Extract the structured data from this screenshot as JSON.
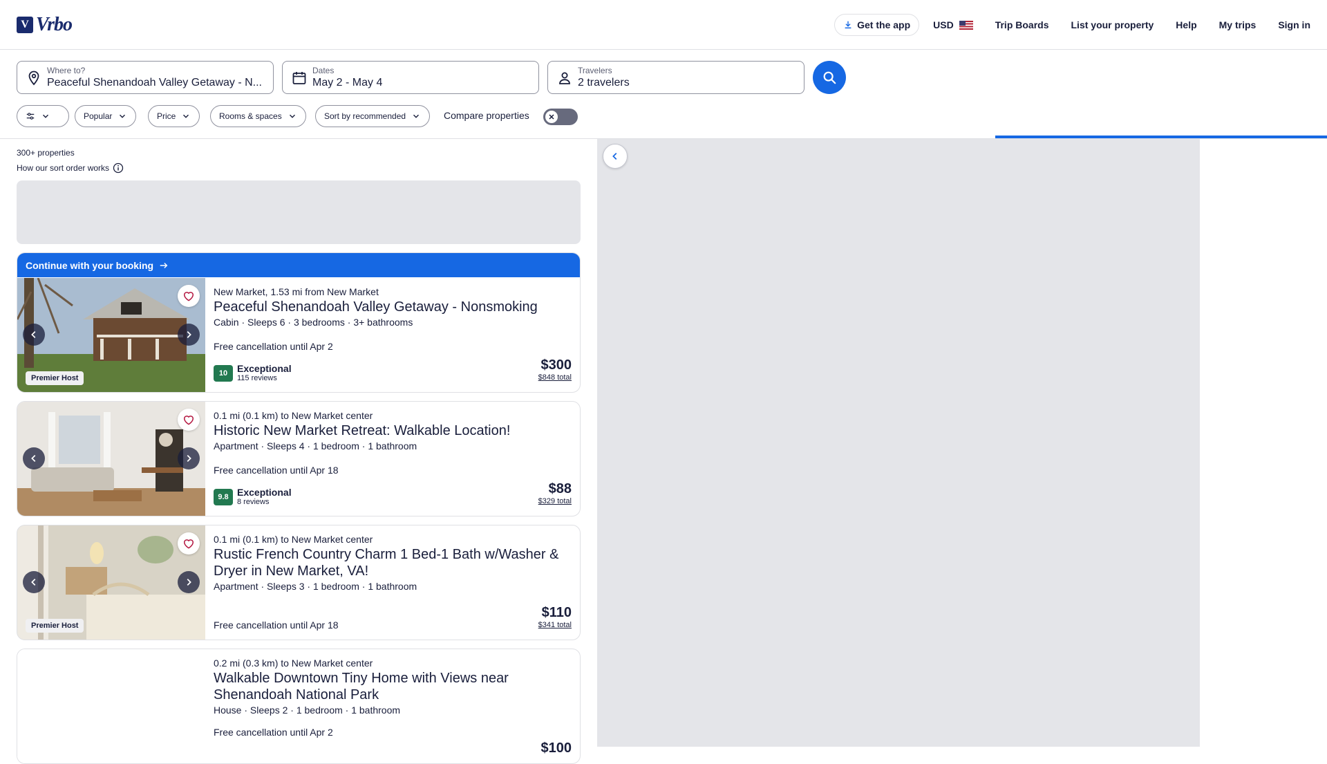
{
  "header": {
    "brand": "Vrbo",
    "get_app": "Get the app",
    "currency": "USD",
    "nav": [
      "Trip Boards",
      "List your property",
      "Help",
      "My trips",
      "Sign in"
    ]
  },
  "search": {
    "destination_label": "Where to?",
    "destination_value": "Peaceful Shenandoah Valley Getaway - N...",
    "dates_label": "Dates",
    "dates_value": "May 2 - May 4",
    "travelers_label": "Travelers",
    "travelers_value": "2 travelers"
  },
  "filters": {
    "popular": "Popular",
    "price": "Price",
    "rooms": "Rooms & spaces",
    "sort": "Sort by recommended",
    "compare": "Compare properties",
    "compare_enabled": false
  },
  "results": {
    "count": "300+ properties",
    "sort_help": "How our sort order works",
    "continue_banner": "Continue with your booking"
  },
  "listings": [
    {
      "location": "New Market, 1.53 mi from New Market",
      "title": "Peaceful Shenandoah Valley Getaway - Nonsmoking",
      "specs": "Cabin · Sleeps 6 · 3 bedrooms · 3+ bathrooms",
      "cancellation": "Free cancellation until Apr 2",
      "score": "10",
      "rating_label": "Exceptional",
      "reviews": "115 reviews",
      "price": "$300",
      "total": "$848 total",
      "badge": "Premier Host"
    },
    {
      "location": "0.1 mi (0.1 km) to New Market center",
      "title": "Historic New Market Retreat: Walkable Location!",
      "specs": "Apartment · Sleeps 4 · 1 bedroom · 1 bathroom",
      "cancellation": "Free cancellation until Apr 18",
      "score": "9.8",
      "rating_label": "Exceptional",
      "reviews": "8 reviews",
      "price": "$88",
      "total": "$329 total"
    },
    {
      "location": "0.1 mi (0.1 km) to New Market center",
      "title": "Rustic French Country Charm 1 Bed-1 Bath w/Washer & Dryer in New Market, VA!",
      "specs": "Apartment · Sleeps 3 · 1 bedroom · 1 bathroom",
      "cancellation": "Free cancellation until Apr 18",
      "price": "$110",
      "total": "$341 total",
      "badge": "Premier Host"
    },
    {
      "location": "0.2 mi (0.3 km) to New Market center",
      "title": "Walkable Downtown Tiny Home with Views near Shenandoah National Park",
      "specs": "House · Sleeps 2 · 1 bedroom · 1 bathroom",
      "cancellation": "Free cancellation until Apr 2",
      "price": "$100"
    }
  ],
  "icons": {
    "location": "map-pin-icon",
    "dates": "calendar-icon",
    "travelers": "person-icon",
    "search": "search-icon",
    "favorite": "heart-icon"
  },
  "colors": {
    "brand_blue": "#1668e3",
    "rating_green": "#227950",
    "heart_red": "#b3153f",
    "text": "#191e3b"
  }
}
